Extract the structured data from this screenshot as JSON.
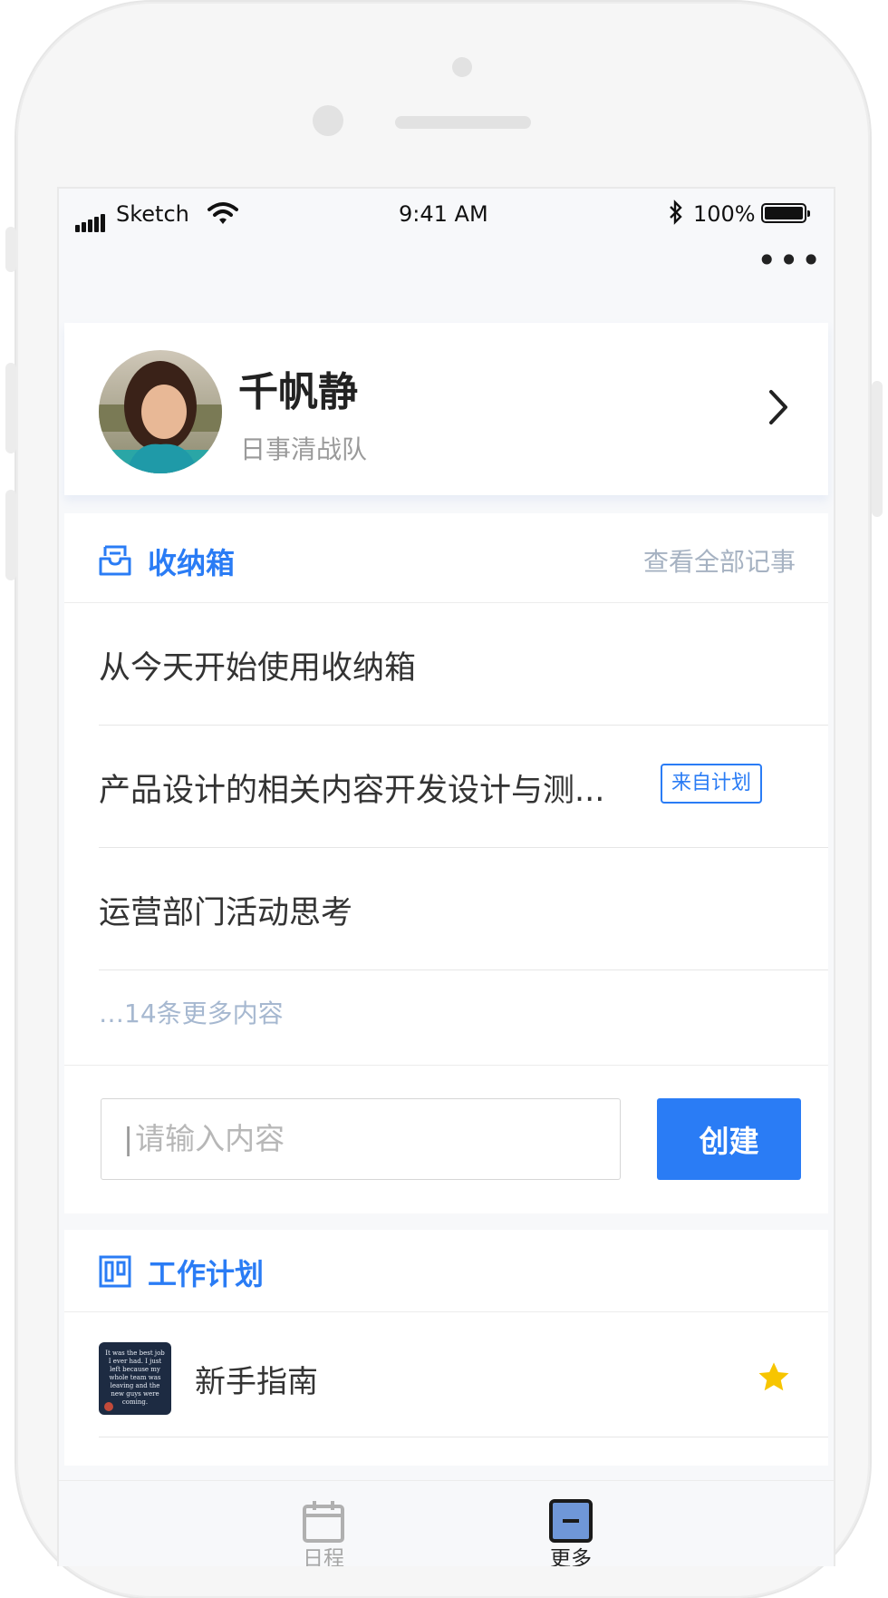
{
  "status_bar": {
    "carrier": "Sketch",
    "time": "9:41 AM",
    "battery": "100%"
  },
  "header": {
    "more_icon": "more-dots-icon"
  },
  "profile": {
    "name": "千帆静",
    "team": "日事清战队"
  },
  "inbox": {
    "title": "收纳箱",
    "view_all": "查看全部记事",
    "items": [
      {
        "text": "从今天开始使用收纳箱"
      },
      {
        "text": "产品设计的相关内容开发设计与测...",
        "tag": "来自计划"
      },
      {
        "text": "运营部门活动思考"
      }
    ],
    "more": "…14条更多内容",
    "input_placeholder": "请输入内容",
    "create_label": "创建"
  },
  "work_plan": {
    "title": "工作计划",
    "items": [
      {
        "name": "新手指南",
        "thumbnail_text": "It was the best job I ever had. I just left because my whole team was leaving and the new guys were coming.",
        "starred": true
      }
    ]
  },
  "tabbar": {
    "tabs": [
      {
        "label": "日程",
        "icon": "calendar-icon",
        "active": false
      },
      {
        "label": "更多",
        "icon": "more-tab-icon",
        "active": true
      }
    ]
  },
  "colors": {
    "accent": "#2a7cf5",
    "star": "#f7c500",
    "muted_link": "#a6b8d0"
  }
}
